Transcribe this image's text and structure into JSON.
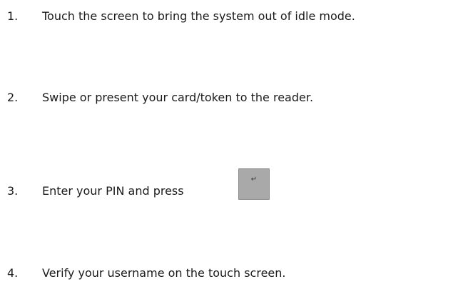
{
  "steps": [
    {
      "number": "1.",
      "text": "Touch the screen to bring the system out of idle mode."
    },
    {
      "number": "2.",
      "text": "Swipe or present your card/token to the reader."
    },
    {
      "number": "3.",
      "text": "Enter your PIN and press",
      "key_glyph": "↵",
      "key_icon": "enter-key-icon"
    },
    {
      "number": "4.",
      "text": "Verify your username on the touch screen."
    }
  ],
  "colors": {
    "text": "#1a1a1a",
    "key_fill": "#a9a9a9",
    "key_border": "#8a8a8a"
  }
}
